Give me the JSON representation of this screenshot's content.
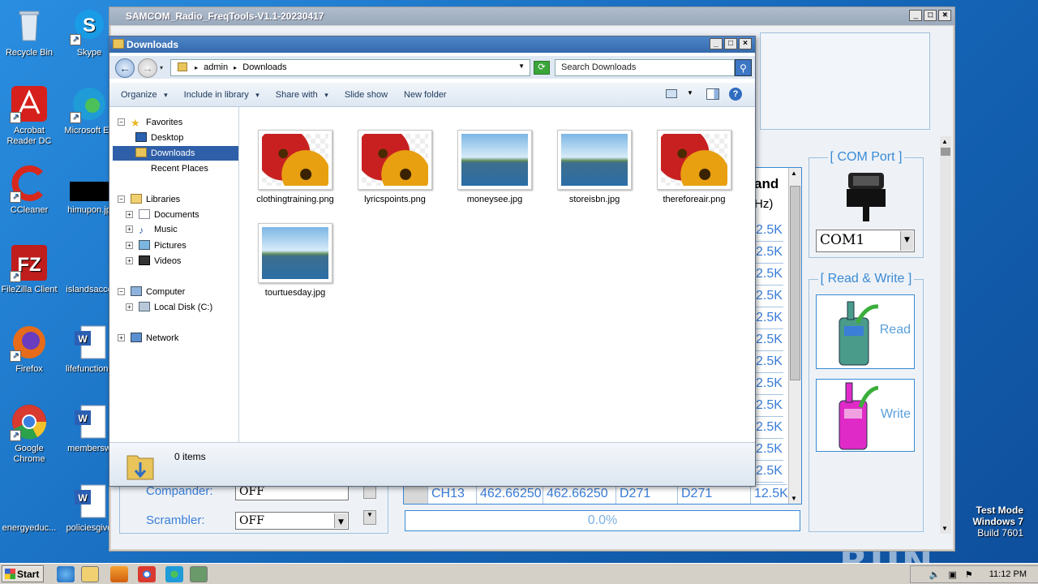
{
  "desktop": {
    "icons": [
      {
        "label": "Recycle Bin",
        "icon": "recycle-bin-icon"
      },
      {
        "label": "Skype",
        "icon": "skype-icon"
      },
      {
        "label": "Acrobat\nReader DC",
        "icon": "acrobat-icon"
      },
      {
        "label": "Microsoft Ed",
        "icon": "edge-icon"
      },
      {
        "label": "CCleaner",
        "icon": "ccleaner-icon"
      },
      {
        "label": "himupon.jp",
        "icon": "image-file-icon"
      },
      {
        "label": "FileZilla Client",
        "icon": "filezilla-icon"
      },
      {
        "label": "islandsacce",
        "icon": "file-icon"
      },
      {
        "label": "Firefox",
        "icon": "firefox-icon"
      },
      {
        "label": "lifefunctions",
        "icon": "word-doc-icon"
      },
      {
        "label": "Google\nChrome",
        "icon": "chrome-icon"
      },
      {
        "label": "membersw",
        "icon": "word-doc-icon"
      },
      {
        "label": "energyeduc...",
        "icon": "file-icon"
      },
      {
        "label": "policiesgive",
        "icon": "word-doc-icon"
      }
    ],
    "watermark": {
      "line1": "Test Mode",
      "line2": "Windows 7",
      "line3": "Build 7601"
    },
    "brand_watermark": "ANY RUN"
  },
  "samcom": {
    "title": "SAMCOM_Radio_FreqTools-V1.1-20230417",
    "com_port_group": "[ COM Port ]",
    "com_port_value": "COM1",
    "read_write_group": "[ Read & Write ]",
    "read_label": "Read",
    "write_label": "Write",
    "table_header": "and",
    "table_header_unit": "Hz)",
    "bandwidth_values": [
      "2.5K",
      "2.5K",
      "2.5K",
      "2.5K",
      "2.5K",
      "2.5K",
      "2.5K",
      "2.5K",
      "2.5K",
      "2.5K",
      "2.5K",
      "2.5K"
    ],
    "last_row": {
      "ch": "CH13",
      "rx": "462.66250",
      "tx": "462.66250",
      "dec": "D271",
      "enc": "D271",
      "bw": "12.5K"
    },
    "progress_text": "0.0%",
    "progress": 0,
    "compander_label": "Compander:",
    "compander_value": "OFF",
    "scrambler_label": "Scrambler:",
    "scrambler_value": "OFF"
  },
  "explorer": {
    "title": "Downloads",
    "breadcrumb": [
      "admin",
      "Downloads"
    ],
    "search_placeholder": "Search Downloads",
    "toolbar": [
      "Organize",
      "Include in library",
      "Share with",
      "Slide show",
      "New folder"
    ],
    "nav": {
      "favorites": "Favorites",
      "desktop": "Desktop",
      "downloads": "Downloads",
      "recent": "Recent Places",
      "libraries": "Libraries",
      "documents": "Documents",
      "music": "Music",
      "pictures": "Pictures",
      "videos": "Videos",
      "computer": "Computer",
      "local_disk": "Local Disk (C:)",
      "network": "Network"
    },
    "files": [
      {
        "name": "clothingtraining.png",
        "kind": "flower"
      },
      {
        "name": "lyricspoints.png",
        "kind": "flower"
      },
      {
        "name": "moneysee.jpg",
        "kind": "landscape"
      },
      {
        "name": "storeisbn.jpg",
        "kind": "landscape"
      },
      {
        "name": "thereforeair.png",
        "kind": "flower"
      },
      {
        "name": "tourtuesday.jpg",
        "kind": "landscape"
      }
    ],
    "status": "0 items"
  },
  "taskbar": {
    "start": "Start",
    "clock": "11:12 PM"
  }
}
